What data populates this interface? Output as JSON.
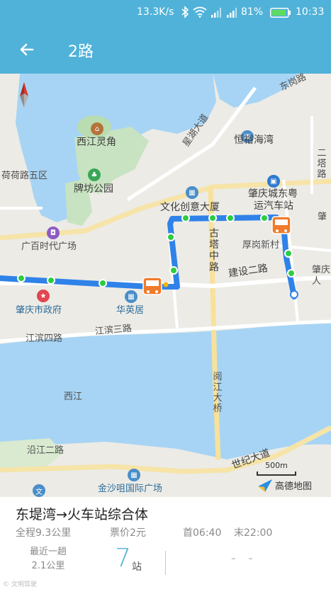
{
  "status_bar": {
    "speed": "13.3K/s",
    "battery": "81%",
    "time": "10:33"
  },
  "header": {
    "title": "2路",
    "back_icon": "arrow-left-icon"
  },
  "map": {
    "labels": {
      "xijiang_linjiao": "西江灵角",
      "paifang_park": "牌坊公园",
      "henyu_haiwan": "恒裕海湾",
      "xingxu_dadao": "星湖大道",
      "heyu_lu": "荷荷路五区",
      "wenhua_chuangyi": "文化创意大厦",
      "zhaoqing_dongyue": "肇庆城东粤",
      "yunqi_chezhan": "运汽车站",
      "guangbai_plaza": "广百时代广场",
      "guta_zhonglu": "古塔中路",
      "houngan_xincun": "厚岗新村",
      "jianshe_erlu": "建设二路",
      "zhaoqing_gov": "肇庆市政府",
      "huaying_ju": "华英居",
      "jiangbin_silu": "江滨四路",
      "jiangbin_sanlu": "江滨三路",
      "xijiang": "西江",
      "yuejiang_daqiao": "阅江大桥",
      "yanjiang_erlu": "沿江二路",
      "shiji_dadao": "世纪大道",
      "jinsha_plaza": "金沙咀国际广场",
      "zhaoqing_ren": "肇庆人",
      "er_ta_lu": "二塔路",
      "zhao_partial": "肇",
      "dongang_lu": "东岗路"
    },
    "scale": "500m",
    "brand": "高德地图"
  },
  "route": {
    "name": "东堤湾→火车站综合体",
    "distance": "全程9.3公里",
    "fare": "票价2元",
    "first_bus": "首06:40",
    "last_bus": "末22:00",
    "recent_label_1": "最近一趟",
    "recent_label_2": "2.1公里",
    "stops": "7",
    "stops_unit": "站",
    "eta": "- -"
  },
  "footer_mark": "© 文明驾驶"
}
